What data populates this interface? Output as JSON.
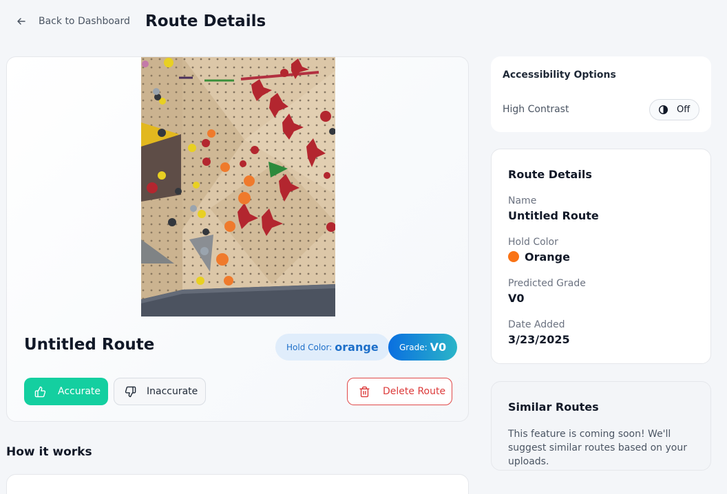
{
  "header": {
    "back_label": "Back to Dashboard",
    "title": "Route Details"
  },
  "route": {
    "name": "Untitled Route",
    "hold_color_label": "Hold Color:",
    "hold_color_value": "orange",
    "grade_label": "Grade:",
    "grade_value": "V0",
    "photo_icon": "climbing-wall-photo"
  },
  "actions": {
    "accurate_label": "Accurate",
    "inaccurate_label": "Inaccurate",
    "delete_label": "Delete Route"
  },
  "how_it_works": {
    "title": "How it works"
  },
  "accessibility": {
    "title": "Accessibility Options",
    "high_contrast_label": "High Contrast",
    "toggle_state": "Off"
  },
  "details": {
    "title": "Route Details",
    "name_label": "Name",
    "name_value": "Untitled Route",
    "color_label": "Hold Color",
    "color_value": "Orange",
    "color_hex": "#f97316",
    "grade_label": "Predicted Grade",
    "grade_value": "V0",
    "date_label": "Date Added",
    "date_value": "3/23/2025"
  },
  "similar": {
    "title": "Similar Routes",
    "text": "This feature is coming soon! We'll suggest similar routes based on your uploads."
  },
  "colors": {
    "accent_green": "#14cfa0",
    "danger_red": "#dc3b3b",
    "grade_gradient_start": "#0a6fe0",
    "grade_gradient_end": "#2bb5c8"
  }
}
